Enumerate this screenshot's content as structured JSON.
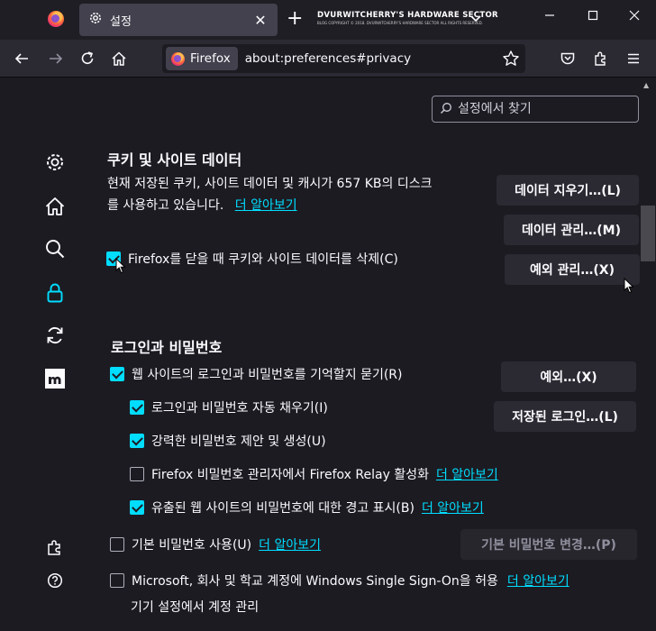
{
  "tabs": {
    "active_title": "설정",
    "brand_main": "DVURWITCHERRY'S HARDWARE SECTOR",
    "brand_sub": "BLOG COPYRIGHT © 2018. DVURWITCHERRY'S HARDWARE SECTOR ALL RIGHTS RESERVED."
  },
  "urlbar": {
    "identity_label": "Firefox",
    "url": "about:preferences#privacy"
  },
  "search": {
    "placeholder": "설정에서 찾기"
  },
  "cookies": {
    "heading": "쿠키 및 사이트 데이터",
    "desc_line1": "현재 저장된 쿠키, 사이트 데이터 및 캐시가 657 KB의 디스크",
    "desc_line2": "를 사용하고 있습니다.",
    "learn_more": "더 알아보기",
    "clear_data_button": "데이터 지우기…(L)",
    "manage_data_button": "데이터 관리…(M)",
    "manage_exceptions_button": "예외 관리…(X)",
    "delete_on_close_label": "Firefox를 닫을 때 쿠키와 사이트 데이터를 삭제(C)",
    "delete_on_close_checked": true
  },
  "logins": {
    "heading": "로그인과 비밀번호",
    "ask_to_save_label": "웹 사이트의 로그인과 비밀번호를 기억할지 묻기(R)",
    "autofill_label": "로그인과 비밀번호 자동 채우기(I)",
    "suggest_label": "강력한 비밀번호 제안 및 생성(U)",
    "relay_label": "Firefox 비밀번호 관리자에서 Firefox Relay 활성화",
    "relay_learn_more": "더 알아보기",
    "breach_label": "유출된 웹 사이트의 비밀번호에 대한 경고 표시(B)",
    "breach_learn_more": "더 알아보기",
    "primary_password_label": "기본 비밀번호 사용(U)",
    "primary_learn_more": "더 알아보기",
    "sso_label": "Microsoft, 회사 및 학교 계정에 Windows Single Sign-On을 허용",
    "sso_learn_more": "더 알아보기",
    "sso_sub": "기기 설정에서 계정 관리",
    "exceptions_button": "예외…(X)",
    "saved_logins_button": "저장된 로그인…(L)",
    "change_primary_button": "기본 비밀번호 변경…(P)",
    "ask_to_save_checked": true,
    "autofill_checked": true,
    "suggest_checked": true,
    "relay_checked": false,
    "breach_checked": true,
    "primary_checked": false,
    "sso_checked": false
  },
  "colors": {
    "accent": "#00ddff",
    "background": "#1c1b22",
    "toolbar": "#2b2a33"
  }
}
